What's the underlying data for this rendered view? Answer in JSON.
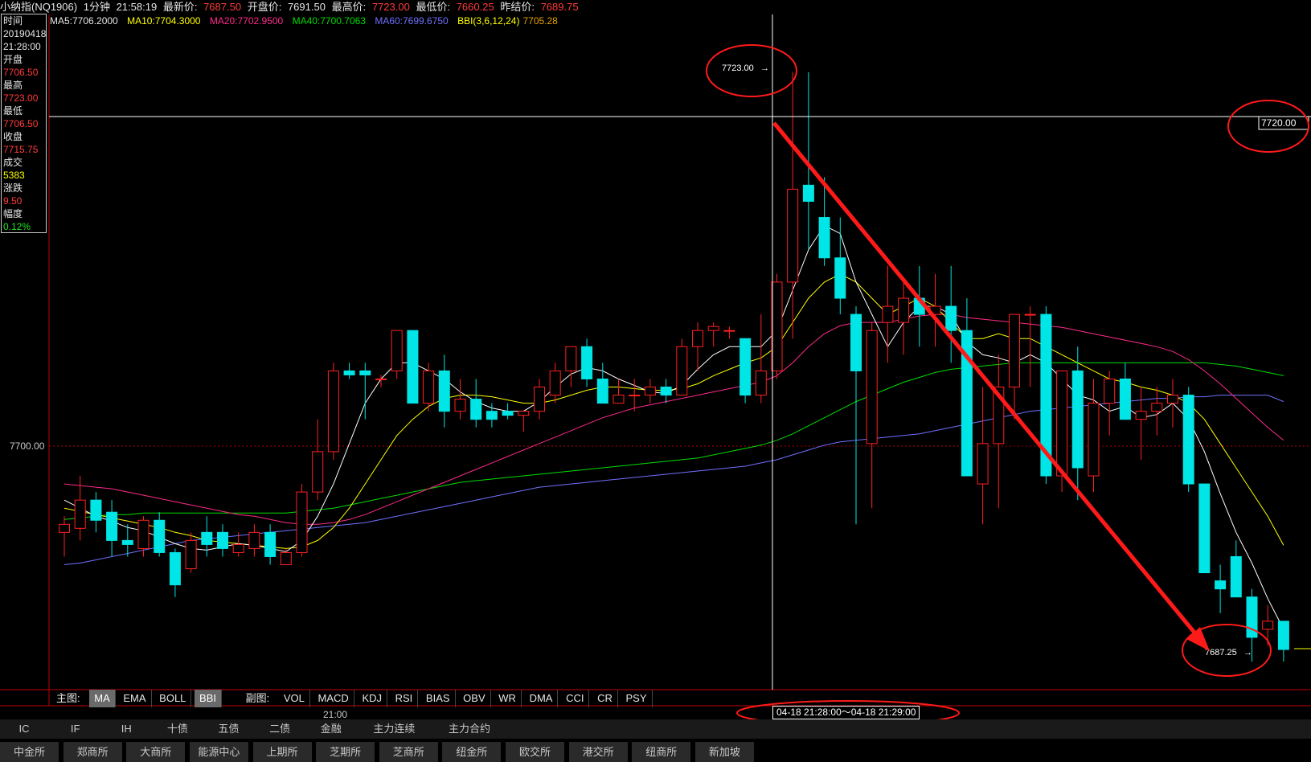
{
  "header": {
    "name": "小纳指(NQ1906)",
    "period": "1分钟",
    "time": "21:58:19",
    "latest_label": "最新价:",
    "latest": "7687.50",
    "open_label": "开盘价:",
    "open": "7691.50",
    "high_label": "最高价:",
    "high": "7723.00",
    "low_label": "最低价:",
    "low": "7660.25",
    "prev_label": "昨结价:",
    "prev": "7689.75"
  },
  "ma_legend": {
    "ma5": "MA5:7706.2000",
    "ma10": "MA10:7704.3000",
    "ma20": "MA20:7702.9500",
    "ma40": "MA40:7700.7063",
    "ma60": "MA60:7699.6750",
    "bbi": "BBI(3,6,12,24)",
    "bbi_val": "7705.28"
  },
  "infobox": {
    "time_label": "时间",
    "date": "20190418",
    "time": "21:28:00",
    "open_label": "开盘",
    "open": "7706.50",
    "high_label": "最高",
    "high": "7723.00",
    "low_label": "最低",
    "low": "7706.50",
    "close_label": "收盘",
    "close": "7715.75",
    "vol_label": "成交",
    "vol": "5383",
    "chg_label": "涨跌",
    "chg": "9.50",
    "amp_label": "幅度",
    "amp": "0.12%"
  },
  "annotations": {
    "top_price": "7723.00",
    "cursor_price": "7720.00",
    "last_price": "7687.25",
    "axis_7700": "7700.00",
    "range": "04-18  21:28:00〜04-18 21:29:00",
    "time_tick": "21:00"
  },
  "indicator_tabs": {
    "main_label": "主图:",
    "main": [
      "MA",
      "EMA",
      "BOLL",
      "BBI"
    ],
    "sub_label": "副图:",
    "sub": [
      "VOL",
      "MACD",
      "KDJ",
      "RSI",
      "BIAS",
      "OBV",
      "WR",
      "DMA",
      "CCI",
      "CR",
      "PSY"
    ]
  },
  "categories_bar": [
    "IC",
    "IF",
    "IH",
    "十债",
    "五债",
    "二债",
    "金融",
    "主力连续",
    "主力合约"
  ],
  "exchanges_bar": [
    "中金所",
    "郑商所",
    "大商所",
    "能源中心",
    "上期所",
    "芝期所",
    "芝商所",
    "纽金所",
    "欧交所",
    "港交所",
    "纽商所",
    "新加坡"
  ],
  "colors": {
    "up": "#ff2020",
    "down": "#00e5e5",
    "ma5": "#ffffff",
    "ma10": "#ffff00",
    "ma20": "#ff2a8a",
    "ma40": "#00dd00",
    "ma60": "#7070ff",
    "bbi": "#e8a000",
    "trend": "#ff1a1a"
  },
  "chart_data": {
    "type": "candlestick",
    "ylim": [
      7682.5,
      7727.5
    ],
    "candles": [
      {
        "o": 7694.5,
        "h": 7695.5,
        "l": 7693.0,
        "c": 7695.0
      },
      {
        "o": 7694.75,
        "h": 7698.0,
        "l": 7694.0,
        "c": 7696.5
      },
      {
        "o": 7696.5,
        "h": 7697.0,
        "l": 7694.5,
        "c": 7695.25
      },
      {
        "o": 7695.75,
        "h": 7696.5,
        "l": 7693.0,
        "c": 7694.0
      },
      {
        "o": 7694.0,
        "h": 7695.0,
        "l": 7693.0,
        "c": 7693.75
      },
      {
        "o": 7693.5,
        "h": 7695.5,
        "l": 7693.0,
        "c": 7695.25
      },
      {
        "o": 7695.25,
        "h": 7695.75,
        "l": 7693.0,
        "c": 7693.25
      },
      {
        "o": 7693.25,
        "h": 7693.5,
        "l": 7690.5,
        "c": 7691.25
      },
      {
        "o": 7692.25,
        "h": 7694.5,
        "l": 7692.0,
        "c": 7694.0
      },
      {
        "o": 7694.5,
        "h": 7695.5,
        "l": 7693.0,
        "c": 7693.75
      },
      {
        "o": 7694.5,
        "h": 7695.0,
        "l": 7693.0,
        "c": 7693.5
      },
      {
        "o": 7693.25,
        "h": 7694.5,
        "l": 7693.0,
        "c": 7693.75
      },
      {
        "o": 7693.5,
        "h": 7695.0,
        "l": 7693.0,
        "c": 7694.5
      },
      {
        "o": 7694.5,
        "h": 7695.0,
        "l": 7692.5,
        "c": 7693.0
      },
      {
        "o": 7692.5,
        "h": 7693.5,
        "l": 7692.5,
        "c": 7693.25
      },
      {
        "o": 7693.25,
        "h": 7697.5,
        "l": 7693.0,
        "c": 7697.0
      },
      {
        "o": 7697.0,
        "h": 7701.5,
        "l": 7696.5,
        "c": 7699.5
      },
      {
        "o": 7699.5,
        "h": 7705.0,
        "l": 7699.0,
        "c": 7704.5
      },
      {
        "o": 7704.5,
        "h": 7705.0,
        "l": 7704.0,
        "c": 7704.25
      },
      {
        "o": 7704.5,
        "h": 7705.0,
        "l": 7701.5,
        "c": 7704.25
      },
      {
        "o": 7704.0,
        "h": 7704.25,
        "l": 7703.5,
        "c": 7704.0
      },
      {
        "o": 7704.5,
        "h": 7707.0,
        "l": 7704.0,
        "c": 7707.0
      },
      {
        "o": 7707.0,
        "h": 7707.0,
        "l": 7703.0,
        "c": 7702.5
      },
      {
        "o": 7702.5,
        "h": 7705.0,
        "l": 7702.0,
        "c": 7704.5
      },
      {
        "o": 7704.5,
        "h": 7705.5,
        "l": 7701.0,
        "c": 7702.0
      },
      {
        "o": 7702.0,
        "h": 7704.0,
        "l": 7701.5,
        "c": 7702.75
      },
      {
        "o": 7702.75,
        "h": 7704.0,
        "l": 7701.0,
        "c": 7701.5
      },
      {
        "o": 7702.0,
        "h": 7702.5,
        "l": 7701.0,
        "c": 7701.5
      },
      {
        "o": 7702.0,
        "h": 7702.5,
        "l": 7701.5,
        "c": 7701.75
      },
      {
        "o": 7701.75,
        "h": 7702.0,
        "l": 7700.75,
        "c": 7702.0
      },
      {
        "o": 7702.0,
        "h": 7704.0,
        "l": 7701.5,
        "c": 7703.5
      },
      {
        "o": 7703.0,
        "h": 7705.0,
        "l": 7702.5,
        "c": 7704.5
      },
      {
        "o": 7704.5,
        "h": 7706.0,
        "l": 7703.5,
        "c": 7706.0
      },
      {
        "o": 7706.0,
        "h": 7706.5,
        "l": 7703.5,
        "c": 7704.0
      },
      {
        "o": 7704.0,
        "h": 7705.0,
        "l": 7702.5,
        "c": 7702.5
      },
      {
        "o": 7702.5,
        "h": 7704.0,
        "l": 7702.5,
        "c": 7703.0
      },
      {
        "o": 7703.0,
        "h": 7704.0,
        "l": 7702.0,
        "c": 7703.0
      },
      {
        "o": 7703.0,
        "h": 7704.0,
        "l": 7702.5,
        "c": 7703.5
      },
      {
        "o": 7703.5,
        "h": 7704.0,
        "l": 7702.5,
        "c": 7703.0
      },
      {
        "o": 7703.0,
        "h": 7706.5,
        "l": 7703.0,
        "c": 7706.0
      },
      {
        "o": 7706.0,
        "h": 7707.5,
        "l": 7704.5,
        "c": 7707.0
      },
      {
        "o": 7707.0,
        "h": 7707.5,
        "l": 7706.0,
        "c": 7707.25
      },
      {
        "o": 7707.0,
        "h": 7707.25,
        "l": 7706.5,
        "c": 7707.0
      },
      {
        "o": 7706.5,
        "h": 7706.5,
        "l": 7702.5,
        "c": 7703.0
      },
      {
        "o": 7703.0,
        "h": 7708.0,
        "l": 7702.5,
        "c": 7704.5
      },
      {
        "o": 7704.5,
        "h": 7710.5,
        "l": 7704.0,
        "c": 7710.0
      },
      {
        "o": 7710.0,
        "h": 7723.0,
        "l": 7706.5,
        "c": 7715.75
      },
      {
        "o": 7716.0,
        "h": 7723.0,
        "l": 7712.0,
        "c": 7715.0
      },
      {
        "o": 7714.0,
        "h": 7716.5,
        "l": 7711.0,
        "c": 7711.5
      },
      {
        "o": 7711.5,
        "h": 7714.0,
        "l": 7708.0,
        "c": 7709.0
      },
      {
        "o": 7708.0,
        "h": 7708.5,
        "l": 7695.0,
        "c": 7704.5
      },
      {
        "o": 7700.0,
        "h": 7707.5,
        "l": 7696.0,
        "c": 7707.0
      },
      {
        "o": 7707.5,
        "h": 7711.0,
        "l": 7705.0,
        "c": 7708.5
      },
      {
        "o": 7707.5,
        "h": 7710.0,
        "l": 7705.5,
        "c": 7709.0
      },
      {
        "o": 7709.0,
        "h": 7711.0,
        "l": 7706.0,
        "c": 7708.0
      },
      {
        "o": 7708.0,
        "h": 7710.5,
        "l": 7706.0,
        "c": 7708.5
      },
      {
        "o": 7708.5,
        "h": 7711.0,
        "l": 7705.0,
        "c": 7707.0
      },
      {
        "o": 7707.0,
        "h": 7709.0,
        "l": 7703.0,
        "c": 7698.0
      },
      {
        "o": 7697.5,
        "h": 7703.5,
        "l": 7695.0,
        "c": 7700.0
      },
      {
        "o": 7700.0,
        "h": 7705.5,
        "l": 7696.0,
        "c": 7703.5
      },
      {
        "o": 7703.5,
        "h": 7708.0,
        "l": 7701.5,
        "c": 7708.0
      },
      {
        "o": 7708.0,
        "h": 7708.5,
        "l": 7703.5,
        "c": 7708.0
      },
      {
        "o": 7708.0,
        "h": 7708.5,
        "l": 7697.5,
        "c": 7698.0
      },
      {
        "o": 7698.0,
        "h": 7704.5,
        "l": 7697.0,
        "c": 7704.5
      },
      {
        "o": 7704.5,
        "h": 7706.0,
        "l": 7696.5,
        "c": 7698.5
      },
      {
        "o": 7698.0,
        "h": 7704.0,
        "l": 7697.0,
        "c": 7702.5
      },
      {
        "o": 7702.5,
        "h": 7704.5,
        "l": 7700.5,
        "c": 7704.0
      },
      {
        "o": 7704.0,
        "h": 7705.0,
        "l": 7701.5,
        "c": 7701.5
      },
      {
        "o": 7701.5,
        "h": 7703.5,
        "l": 7699.0,
        "c": 7702.0
      },
      {
        "o": 7702.0,
        "h": 7703.5,
        "l": 7700.5,
        "c": 7702.5
      },
      {
        "o": 7702.5,
        "h": 7704.0,
        "l": 7701.0,
        "c": 7703.0
      },
      {
        "o": 7703.0,
        "h": 7703.5,
        "l": 7697.0,
        "c": 7697.5
      },
      {
        "o": 7697.5,
        "h": 7697.5,
        "l": 7692.0,
        "c": 7692.0
      },
      {
        "o": 7691.5,
        "h": 7692.5,
        "l": 7689.5,
        "c": 7691.0
      },
      {
        "o": 7693.0,
        "h": 7694.0,
        "l": 7690.5,
        "c": 7690.5
      },
      {
        "o": 7690.5,
        "h": 7691.0,
        "l": 7686.5,
        "c": 7688.0
      },
      {
        "o": 7688.5,
        "h": 7690.0,
        "l": 7687.5,
        "c": 7689.0
      },
      {
        "o": 7689.0,
        "h": 7689.0,
        "l": 7686.5,
        "c": 7687.25
      }
    ],
    "ma5": [
      7696.5,
      7696.0,
      7695.5,
      7695.2,
      7694.8,
      7694.6,
      7694.2,
      7693.8,
      7693.5,
      7693.4,
      7693.6,
      7693.8,
      7693.7,
      7693.5,
      7693.3,
      7694.0,
      7695.5,
      7697.5,
      7700.0,
      7702.5,
      7704.0,
      7705.0,
      7705.0,
      7704.5,
      7704.0,
      7703.2,
      7702.6,
      7702.2,
      7702.0,
      7702.0,
      7702.6,
      7703.5,
      7704.3,
      7704.7,
      7704.5,
      7704.0,
      7703.6,
      7703.2,
      7703.1,
      7703.6,
      7704.6,
      7705.5,
      7706.0,
      7706.0,
      7706.0,
      7707.0,
      7709.5,
      7712.0,
      7713.5,
      7713.0,
      7710.0,
      7708.0,
      7706.0,
      7707.5,
      7708.5,
      7708.5,
      7708.0,
      7706.3,
      7705.5,
      7705.3,
      7705.0,
      7705.5,
      7705.0,
      7704.0,
      7703.0,
      7702.7,
      7702.0,
      7702.3,
      7701.6,
      7701.8,
      7702.5,
      7701.5,
      7699.5,
      7696.9,
      7694.5,
      7692.6,
      7690.4,
      7688.5
    ],
    "ma10": [
      7696.0,
      7695.8,
      7695.6,
      7695.4,
      7695.2,
      7695.0,
      7694.8,
      7694.5,
      7694.3,
      7694.0,
      7693.9,
      7693.8,
      7693.7,
      7693.6,
      7693.5,
      7693.6,
      7694.0,
      7694.8,
      7696.0,
      7697.5,
      7699.0,
      7700.5,
      7701.5,
      7702.3,
      7702.8,
      7703.0,
      7703.0,
      7702.9,
      7702.7,
      7702.5,
      7702.5,
      7702.7,
      7703.0,
      7703.3,
      7703.5,
      7703.5,
      7703.4,
      7703.3,
      7703.3,
      7703.4,
      7703.7,
      7704.2,
      7704.6,
      7705.0,
      7705.3,
      7706.0,
      7707.5,
      7709.0,
      7710.0,
      7710.5,
      7710.0,
      7709.0,
      7708.0,
      7708.5,
      7709.0,
      7708.5,
      7707.5,
      7706.5,
      7706.5,
      7706.8,
      7706.5,
      7706.5,
      7706.0,
      7705.5,
      7705.0,
      7704.5,
      7704.0,
      7703.8,
      7703.5,
      7703.3,
      7703.0,
      7702.5,
      7701.5,
      7700.0,
      7698.5,
      7697.0,
      7695.5,
      7693.7
    ],
    "ma20": [
      7697.5,
      7697.4,
      7697.3,
      7697.2,
      7697.0,
      7696.8,
      7696.6,
      7696.4,
      7696.2,
      7696.0,
      7695.8,
      7695.6,
      7695.5,
      7695.3,
      7695.1,
      7695.0,
      7695.0,
      7695.1,
      7695.3,
      7695.6,
      7696.0,
      7696.4,
      7696.8,
      7697.2,
      7697.6,
      7698.0,
      7698.4,
      7698.8,
      7699.2,
      7699.6,
      7700.0,
      7700.4,
      7700.8,
      7701.2,
      7701.6,
      7701.9,
      7702.2,
      7702.4,
      7702.6,
      7702.8,
      7703.0,
      7703.2,
      7703.4,
      7703.6,
      7703.8,
      7704.2,
      7705.0,
      7706.0,
      7706.8,
      7707.3,
      7707.5,
      7707.5,
      7707.5,
      7707.7,
      7707.9,
      7708.0,
      7708.0,
      7707.8,
      7707.7,
      7707.6,
      7707.5,
      7707.4,
      7707.3,
      7707.2,
      7707.0,
      7706.8,
      7706.6,
      7706.4,
      7706.2,
      7706.0,
      7705.7,
      7705.2,
      7704.5,
      7703.7,
      7702.8,
      7701.9,
      7701.0,
      7700.2
    ],
    "ma40": [
      7695.3,
      7695.4,
      7695.5,
      7695.6,
      7695.6,
      7695.7,
      7695.7,
      7695.7,
      7695.7,
      7695.7,
      7695.7,
      7695.7,
      7695.7,
      7695.7,
      7695.7,
      7695.8,
      7695.9,
      7696.0,
      7696.2,
      7696.4,
      7696.6,
      7696.8,
      7697.0,
      7697.2,
      7697.4,
      7697.6,
      7697.7,
      7697.8,
      7697.9,
      7698.0,
      7698.1,
      7698.2,
      7698.3,
      7698.4,
      7698.5,
      7698.6,
      7698.7,
      7698.8,
      7698.9,
      7699.0,
      7699.1,
      7699.3,
      7699.5,
      7699.7,
      7699.9,
      7700.2,
      7700.6,
      7701.1,
      7701.6,
      7702.1,
      7702.6,
      7703.0,
      7703.4,
      7703.8,
      7704.1,
      7704.4,
      7704.6,
      7704.7,
      7704.8,
      7704.9,
      7705.0,
      7705.0,
      7705.0,
      7705.0,
      7705.0,
      7705.0,
      7705.0,
      7705.0,
      7705.0,
      7705.0,
      7705.0,
      7705.0,
      7705.0,
      7704.9,
      7704.8,
      7704.6,
      7704.4,
      7704.2
    ],
    "ma60": [
      7692.5,
      7692.6,
      7692.8,
      7693.0,
      7693.2,
      7693.4,
      7693.6,
      7693.8,
      7694.0,
      7694.1,
      7694.2,
      7694.3,
      7694.4,
      7694.5,
      7694.6,
      7694.7,
      7694.8,
      7694.9,
      7695.0,
      7695.1,
      7695.3,
      7695.5,
      7695.7,
      7695.9,
      7696.1,
      7696.3,
      7696.5,
      7696.7,
      7696.9,
      7697.1,
      7697.3,
      7697.4,
      7697.5,
      7697.6,
      7697.7,
      7697.8,
      7697.9,
      7698.0,
      7698.1,
      7698.2,
      7698.3,
      7698.4,
      7698.5,
      7698.6,
      7698.8,
      7699.0,
      7699.3,
      7699.6,
      7699.9,
      7700.1,
      7700.2,
      7700.3,
      7700.4,
      7700.5,
      7700.6,
      7700.8,
      7701.0,
      7701.2,
      7701.4,
      7701.6,
      7701.8,
      7702.0,
      7702.1,
      7702.2,
      7702.3,
      7702.4,
      7702.5,
      7702.6,
      7702.7,
      7702.8,
      7702.8,
      7702.9,
      7702.9,
      7703.0,
      7703.0,
      7703.0,
      7703.0,
      7702.6
    ]
  }
}
